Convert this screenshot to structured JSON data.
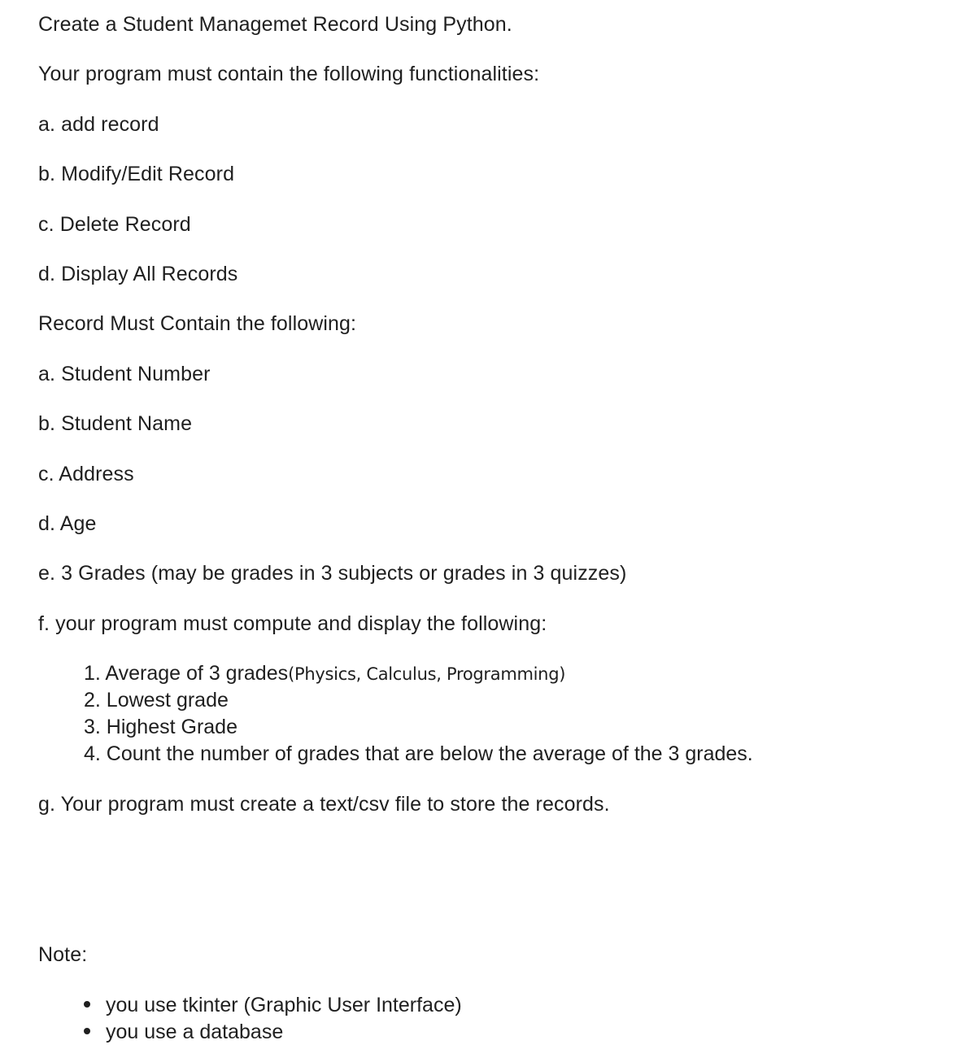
{
  "title": "Create a Student Managemet Record Using Python.",
  "functionalities_intro": "Your program must contain the following functionalities:",
  "functionalities": [
    "a. add record",
    "b. Modify/Edit Record",
    "c. Delete Record",
    "d. Display All Records"
  ],
  "record_intro": "Record Must Contain the following:",
  "record_fields": [
    "a. Student Number",
    "b. Student Name",
    "c. Address",
    "d. Age",
    "e. 3 Grades (may be grades in 3 subjects or grades in 3 quizzes)",
    "f. your program must compute and display the following:"
  ],
  "computations": [
    {
      "text": "1. Average of 3 grades",
      "note": "(Physics, Calculus, Programming)"
    },
    {
      "text": "2. Lowest grade",
      "note": ""
    },
    {
      "text": "3. Highest Grade",
      "note": ""
    },
    {
      "text": "4. Count the number of grades that are below the average of the 3 grades.",
      "note": ""
    }
  ],
  "file_requirement": "g. Your program must create a text/csv file to store the records.",
  "note_label": "Note:",
  "note_items": [
    "you use tkinter (Graphic User Interface)",
    "you use a database"
  ]
}
